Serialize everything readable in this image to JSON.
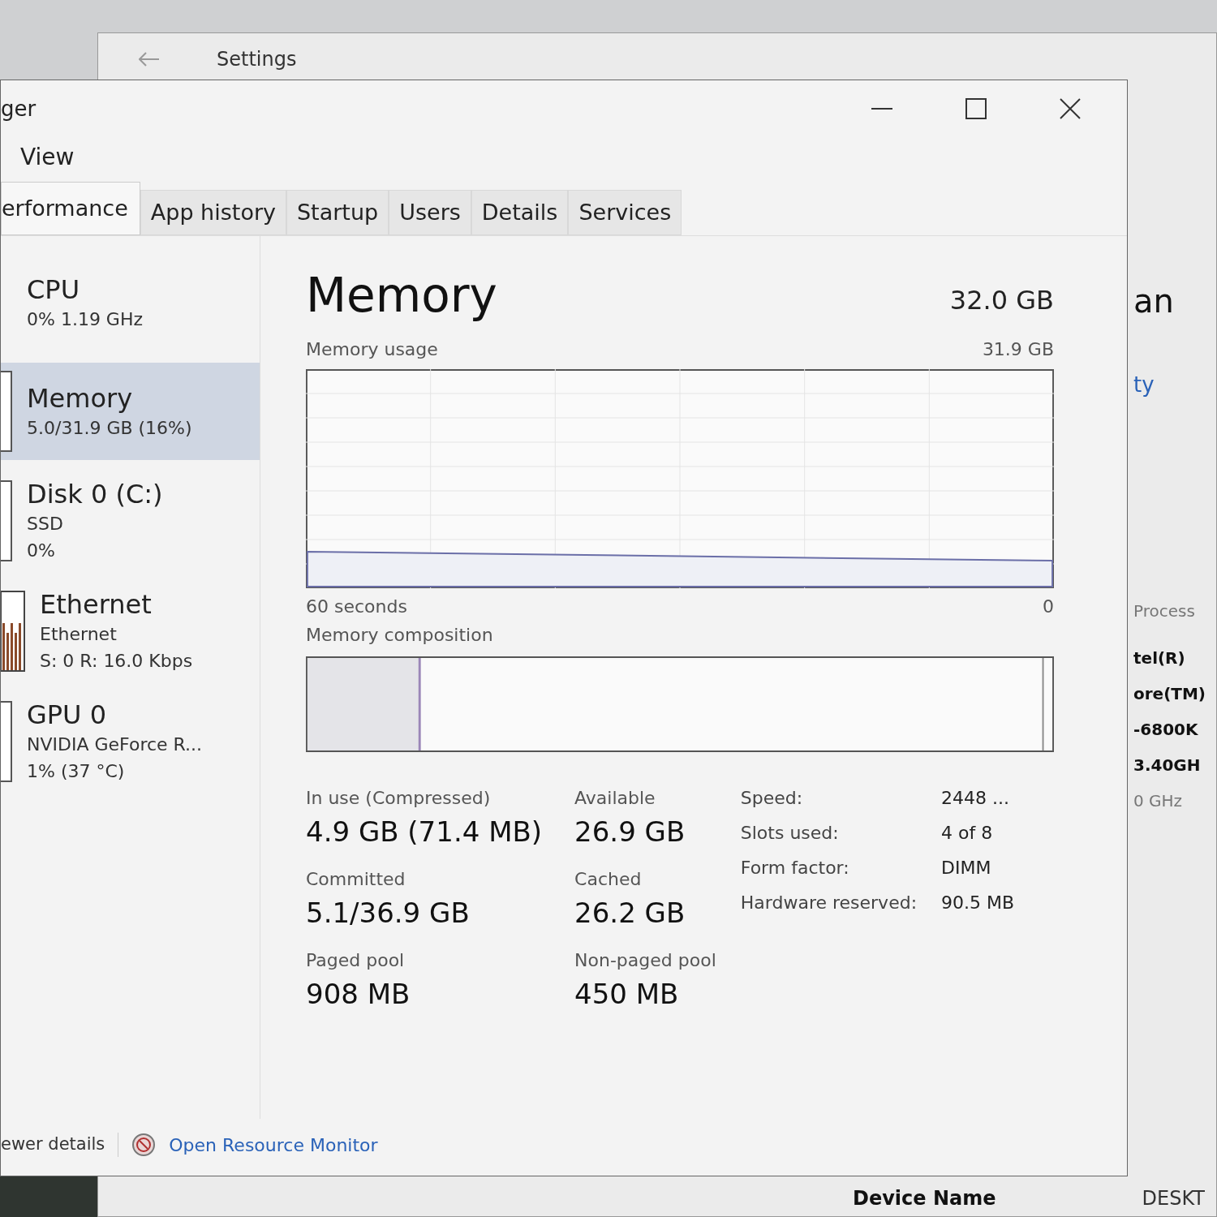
{
  "back_window": {
    "title": "Settings",
    "right_texts": [
      {
        "text": "an",
        "kind": "heading"
      },
      {
        "text": "ty",
        "kind": "link"
      },
      {
        "text": "Process",
        "kind": "label"
      },
      {
        "text": "tel(R)",
        "kind": "value"
      },
      {
        "text": "ore(TM)",
        "kind": "value"
      },
      {
        "text": "-6800K",
        "kind": "value"
      },
      {
        "text": "3.40GH",
        "kind": "value"
      },
      {
        "text": "0 GHz",
        "kind": "label"
      }
    ],
    "bottom_texts": [
      "Device Name",
      "DESKT"
    ]
  },
  "window": {
    "title": "ger"
  },
  "menu": [
    "View"
  ],
  "tabs": [
    {
      "label": "erformance",
      "selected": true
    },
    {
      "label": "App history",
      "selected": false
    },
    {
      "label": "Startup",
      "selected": false
    },
    {
      "label": "Users",
      "selected": false
    },
    {
      "label": "Details",
      "selected": false
    },
    {
      "label": "Services",
      "selected": false
    }
  ],
  "sidebar": {
    "items": [
      {
        "title": "CPU",
        "lines": [
          "0% 1.19 GHz"
        ],
        "selected": false,
        "kind": "none"
      },
      {
        "title": "Memory",
        "lines": [
          "5.0/31.9 GB (16%)"
        ],
        "selected": true,
        "kind": "empty"
      },
      {
        "title": "Disk 0 (C:)",
        "lines": [
          "SSD",
          "0%"
        ],
        "selected": false,
        "kind": "empty"
      },
      {
        "title": "Ethernet",
        "lines": [
          "Ethernet",
          "S: 0 R: 16.0 Kbps"
        ],
        "selected": false,
        "kind": "bars"
      },
      {
        "title": "GPU 0",
        "lines": [
          "NVIDIA GeForce R...",
          "1% (37 °C)"
        ],
        "selected": false,
        "kind": "empty"
      }
    ]
  },
  "main": {
    "title": "Memory",
    "total": "32.0 GB",
    "usage_label": "Memory usage",
    "usage_max": "31.9 GB",
    "time_span": "60 seconds",
    "usage_min": "0",
    "composition_label": "Memory composition",
    "stats": [
      {
        "label": "In use (Compressed)",
        "value": "4.9 GB (71.4 MB)"
      },
      {
        "label": "Available",
        "value": "26.9 GB"
      },
      {
        "label": "Committed",
        "value": "5.1/36.9 GB"
      },
      {
        "label": "Cached",
        "value": "26.2 GB"
      },
      {
        "label": "Paged pool",
        "value": "908 MB"
      },
      {
        "label": "Non-paged pool",
        "value": "450 MB"
      }
    ],
    "info": [
      {
        "label": "Speed:",
        "value": "2448 ..."
      },
      {
        "label": "Slots used:",
        "value": "4 of 8"
      },
      {
        "label": "Form factor:",
        "value": "DIMM"
      },
      {
        "label": "Hardware reserved:",
        "value": "90.5 MB"
      }
    ]
  },
  "footer": {
    "details_link": "ewer details",
    "monitor_link": "Open Resource Monitor"
  }
}
